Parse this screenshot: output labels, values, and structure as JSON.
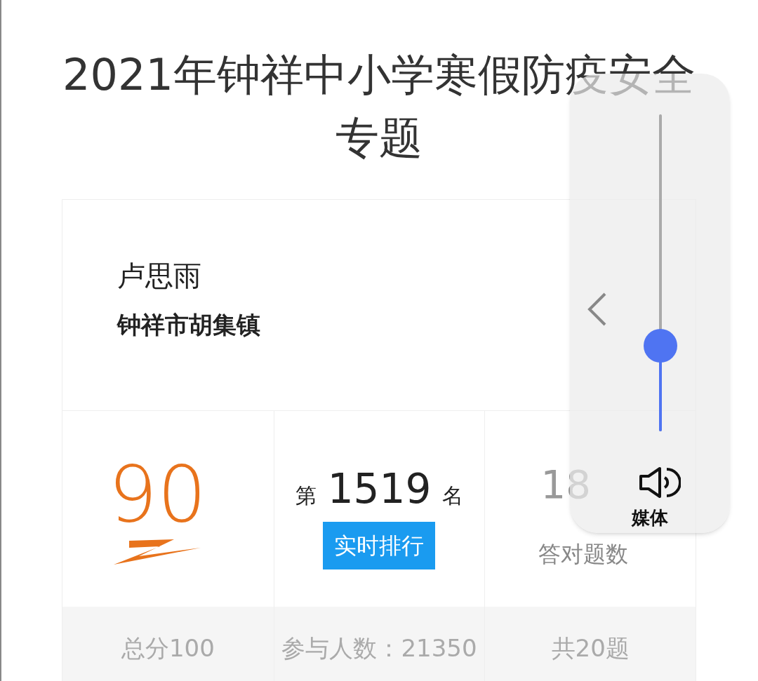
{
  "title": "2021年钟祥中小学寒假防疫安全专题",
  "profile": {
    "name": "卢思雨",
    "location": "钟祥市胡集镇"
  },
  "stats": [
    {
      "kind": "score",
      "value": "90",
      "footer": "总分100"
    },
    {
      "kind": "rank",
      "prefix": "第",
      "value": "1519",
      "suffix": "名",
      "button": "实时排行",
      "footer": "参与人数：21350"
    },
    {
      "kind": "correct",
      "value": "18",
      "caption": "答对题数",
      "footer": "共20题"
    }
  ],
  "volume_panel": {
    "level": 0.27,
    "label": "媒体"
  }
}
